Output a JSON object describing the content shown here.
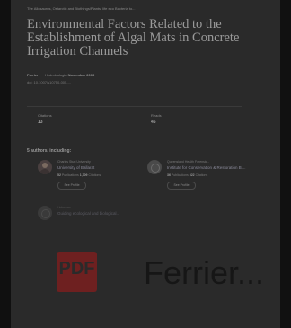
{
  "source_line": "The Allosaurus, Ostarctic and Biothings/Plants, life eco Bacteria to...",
  "title": "Environmental Factors Related to the Establishment of Algal Mats in Concrete Irrigation Channels",
  "byline": {
    "author": "Ferrier",
    "separator": "·",
    "journal": "Hydrobiologia",
    "date": "November 2005"
  },
  "doi": "doi: 10.1007/s10750-005-...",
  "stats": [
    {
      "label": "Citations",
      "value": "13"
    },
    {
      "label": "Reads",
      "value": "46"
    }
  ],
  "authors_section_title": "5 authors, including:",
  "authors": [
    {
      "institution": "Charles Sturt University",
      "name": "University of Ballarat",
      "stats_count1": "52",
      "stats_label1": "Publications",
      "stats_count2": "1,709",
      "stats_label2": "Citations",
      "button": "See Profile",
      "avatar": "person-photo-avatar"
    },
    {
      "institution": "Queensland Health Forensic...",
      "name": "Institute for Conservation & Restoration Bi...",
      "stats_count1": "36",
      "stats_label1": "Publications",
      "stats_count2": "522",
      "stats_label2": "Citations",
      "button": "See Profile",
      "avatar": "generic-user-avatar"
    },
    {
      "institution": "Unknown",
      "name": "Guiding ecological and biological...",
      "avatar": "generic-user-avatar"
    }
  ],
  "thumbnail": {
    "pdf_label": "PDF",
    "title_text": "Ferrier..."
  }
}
